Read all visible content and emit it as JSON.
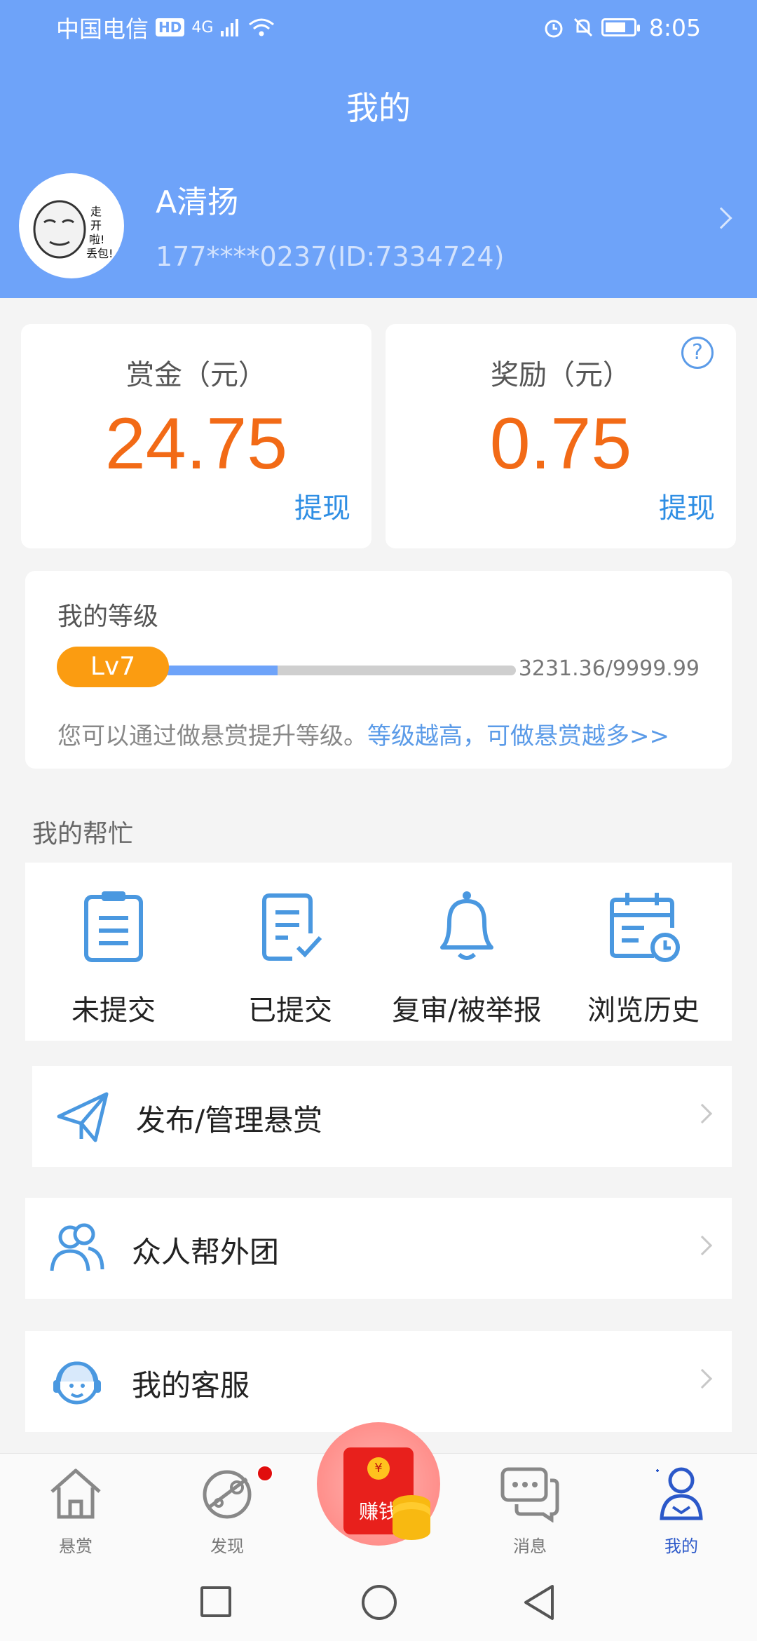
{
  "status_bar": {
    "carrier": "中国电信",
    "hd": "HD",
    "network": "4G",
    "time": "8:05"
  },
  "header": {
    "title": "我的"
  },
  "profile": {
    "name": "A清扬",
    "sub": "177****0237(ID:7334724)",
    "avatar_text": "走开啦！丢包！"
  },
  "bounty_card": {
    "label": "赏金（元）",
    "value": "24.75",
    "action": "提现"
  },
  "reward_card": {
    "label": "奖励（元）",
    "value": "0.75",
    "action": "提现",
    "help": "?"
  },
  "level": {
    "title": "我的等级",
    "badge": "Lv7",
    "progress_text": "3231.36/9999.99",
    "progress_fraction": 0.3231,
    "tip": "您可以通过做悬赏提升等级。",
    "tip_link": "等级越高，可做悬赏越多>>"
  },
  "my_help": {
    "section_label": "我的帮忙",
    "items": [
      {
        "label": "未提交",
        "icon": "clipboard-icon"
      },
      {
        "label": "已提交",
        "icon": "checked-document-icon"
      },
      {
        "label": "复审/被举报",
        "icon": "bell-icon"
      },
      {
        "label": "浏览历史",
        "icon": "calendar-clock-icon"
      }
    ]
  },
  "menu": [
    {
      "label": "发布/管理悬赏",
      "icon": "paper-plane-icon"
    },
    {
      "label": "众人帮外团",
      "icon": "group-icon"
    },
    {
      "label": "我的客服",
      "icon": "customer-service-icon"
    }
  ],
  "bottom_nav": {
    "items": [
      {
        "label": "悬赏",
        "icon": "house-icon"
      },
      {
        "label": "发现",
        "icon": "planet-icon"
      },
      {
        "label": "赚钱",
        "icon": "red-packet-icon"
      },
      {
        "label": "消息",
        "icon": "chat-icon"
      },
      {
        "label": "我的",
        "icon": "person-icon"
      }
    ],
    "active": "我的"
  },
  "colors": {
    "header_bg": "#6ea3f9",
    "amount": "#f26a16",
    "link": "#2e8ee4",
    "badge": "#fb9c11",
    "nav_active": "#2b58c9"
  }
}
